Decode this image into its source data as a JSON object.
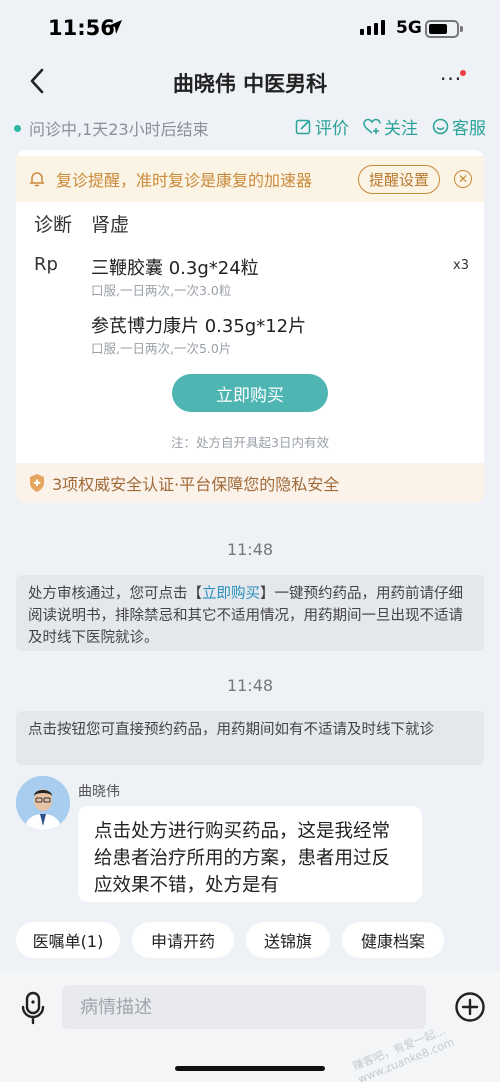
{
  "status": {
    "time": "11:56",
    "network": "5G"
  },
  "nav": {
    "title": "曲晓伟 中医男科"
  },
  "consult": {
    "status_text": "问诊中,1天23小时后结束",
    "actions": {
      "rate": "评价",
      "follow": "关注",
      "service": "客服"
    }
  },
  "reminder": {
    "text": "复诊提醒，准时复诊是康复的加速器",
    "button": "提醒设置"
  },
  "prescription": {
    "diagnosis_label": "诊断",
    "diagnosis": "肾虚",
    "rp_label": "Rp",
    "quantity": "x3",
    "drugs": [
      {
        "name": "三鞭胶囊 0.3g*24粒",
        "usage": "口服,一日两次,一次3.0粒"
      },
      {
        "name": "参芪博力康片 0.35g*12片",
        "usage": "口服,一日两次,一次5.0片"
      }
    ],
    "buy_button": "立即购买",
    "note": "注：处方自开具起3日内有效"
  },
  "security": {
    "text": "3项权威安全认证·平台保障您的隐私安全"
  },
  "chat": {
    "time1": "11:48",
    "msg1_part1": "处方审核通过，您可点击【",
    "msg1_link": "立即购买",
    "msg1_part2": "】一键预约药品，用药前请仔细阅读说明书，排除禁忌和其它不适用情况，用药期间一旦出现不适请及时线下医院就诊。",
    "time2": "11:48",
    "msg2": "点击按钮您可直接预约药品，用药期间如有不适请及时线下就诊",
    "sender": "曲晓伟",
    "bubble": "点击处方进行购买药品，这是我经常给患者治疗所用的方案，患者用过反应效果不错，处方是有"
  },
  "quick_actions": [
    "医嘱单(1)",
    "申请开药",
    "送锦旗",
    "健康档案"
  ],
  "input": {
    "placeholder": "病情描述"
  },
  "watermark": "赚客吧，有爱一起…  www.zuanke8.com",
  "colors": {
    "accent": "#4eb5b3",
    "teal": "#2aa39a",
    "warning": "#c98a3c",
    "link": "#2a8fbd"
  }
}
